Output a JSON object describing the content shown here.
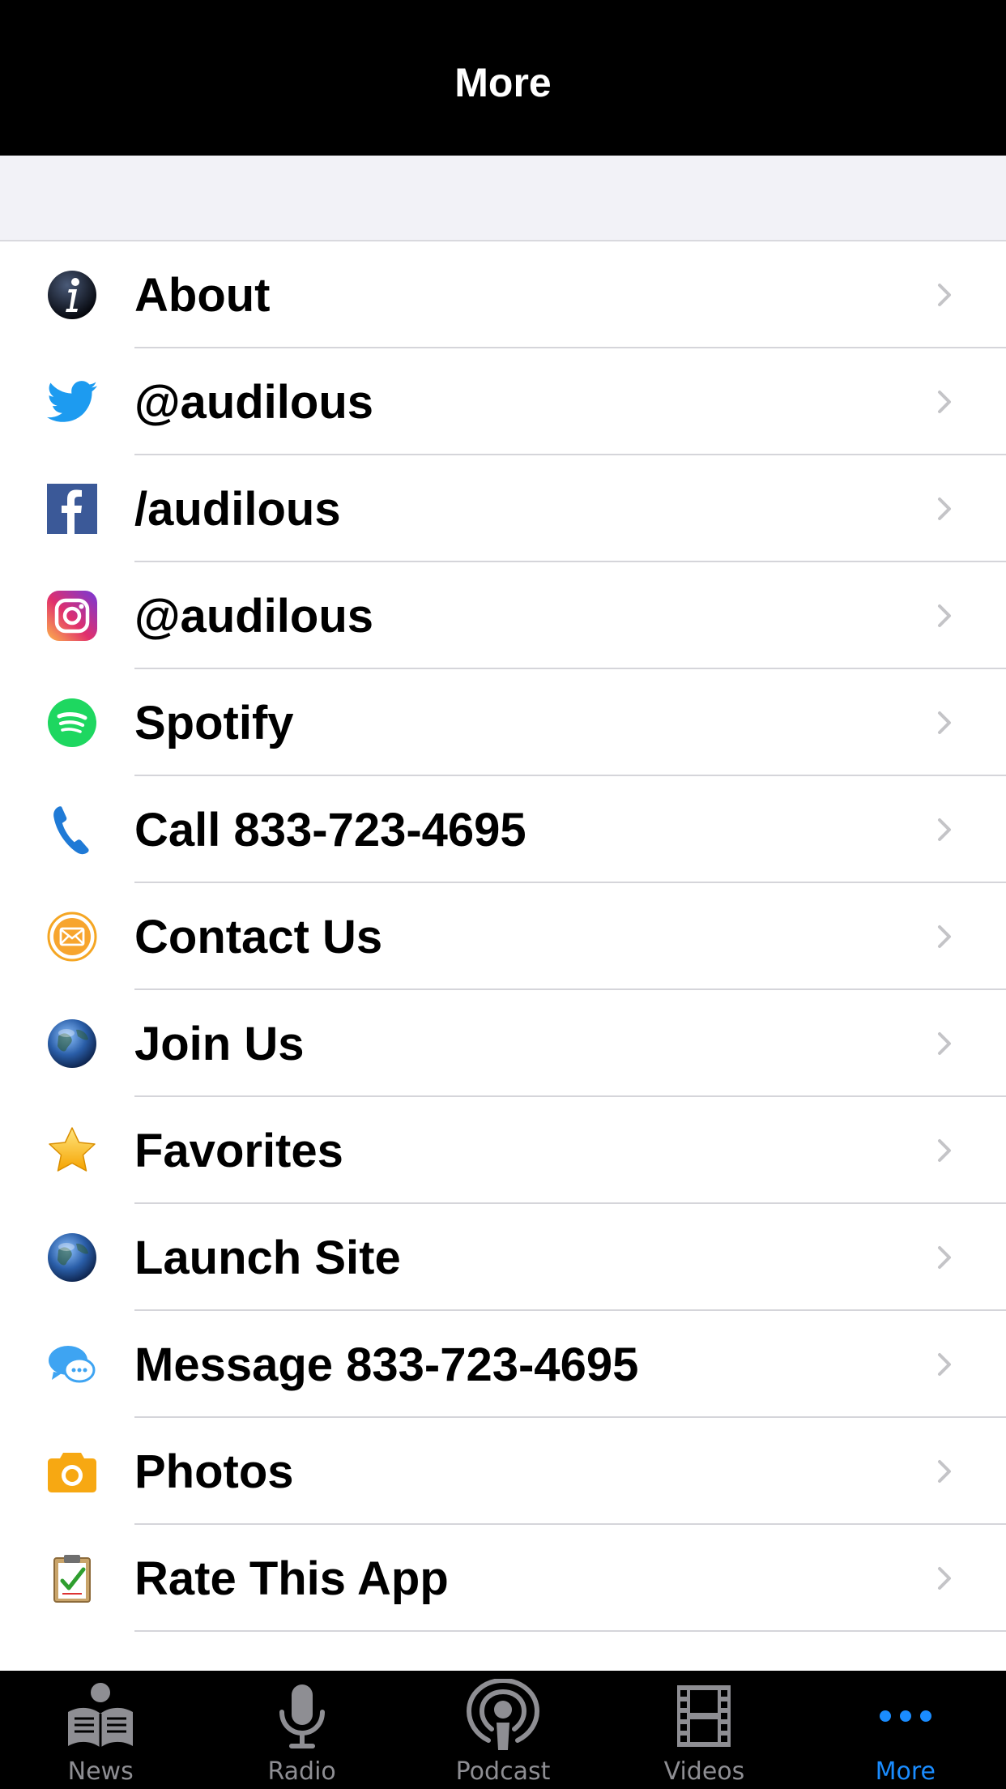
{
  "navbar": {
    "title": "More"
  },
  "list": {
    "items": [
      {
        "label": "About",
        "icon": "info-icon"
      },
      {
        "label": "@audilous",
        "icon": "twitter-icon"
      },
      {
        "label": "/audilous",
        "icon": "facebook-icon"
      },
      {
        "label": "@audilous",
        "icon": "instagram-icon"
      },
      {
        "label": "Spotify",
        "icon": "spotify-icon"
      },
      {
        "label": "Call 833-723-4695",
        "icon": "phone-icon"
      },
      {
        "label": "Contact Us",
        "icon": "mail-icon"
      },
      {
        "label": "Join Us",
        "icon": "globe-icon"
      },
      {
        "label": "Favorites",
        "icon": "star-icon"
      },
      {
        "label": "Launch Site",
        "icon": "globe-icon"
      },
      {
        "label": "Message 833-723-4695",
        "icon": "message-icon"
      },
      {
        "label": "Photos",
        "icon": "camera-icon"
      },
      {
        "label": "Rate This App",
        "icon": "clipboard-icon"
      }
    ]
  },
  "tabbar": {
    "tabs": [
      {
        "label": "News",
        "icon": "newspaper-icon",
        "active": false
      },
      {
        "label": "Radio",
        "icon": "microphone-icon",
        "active": false
      },
      {
        "label": "Podcast",
        "icon": "podcast-icon",
        "active": false
      },
      {
        "label": "Videos",
        "icon": "film-icon",
        "active": false
      },
      {
        "label": "More",
        "icon": "more-dots-icon",
        "active": true
      }
    ]
  },
  "colors": {
    "navbar_bg": "#000000",
    "accent": "#1a8cff",
    "tab_inactive": "#8e8e93",
    "group_bg": "#f2f2f7"
  }
}
